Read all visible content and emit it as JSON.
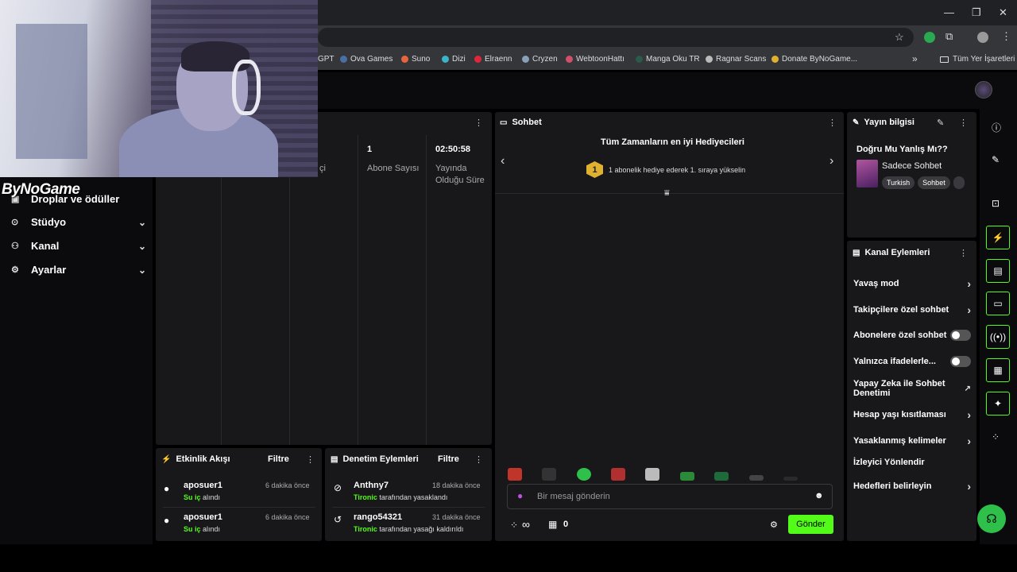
{
  "browser": {
    "bookmarks": [
      {
        "label": "GPT",
        "color": "#888"
      },
      {
        "label": "Ova Games",
        "color": "#4a6fa5"
      },
      {
        "label": "Suno",
        "color": "#e8643c"
      },
      {
        "label": "Dizi",
        "color": "#3cb4c8"
      },
      {
        "label": "Elraenn",
        "color": "#e0263b"
      },
      {
        "label": "Cryzen",
        "color": "#8aa0b8"
      },
      {
        "label": "WebtoonHattı",
        "color": "#d0506a"
      },
      {
        "label": "Manga Oku TR",
        "color": "#2a5a4a"
      },
      {
        "label": "Ragnar Scans",
        "color": "#bbbbbb"
      },
      {
        "label": "Donate ByNoGame...",
        "color": "#e0b030"
      }
    ],
    "more_bookmarks": "»",
    "all_bookmarks": "Tüm Yer İşaretleri"
  },
  "overlay": {
    "logo_text": "ByNoGame"
  },
  "sidebar": {
    "partial_item": "Droplar ve ödüller",
    "items": [
      {
        "label": "Stüdyo",
        "icon": "studio-icon"
      },
      {
        "label": "Kanal",
        "icon": "users-icon"
      },
      {
        "label": "Ayarlar",
        "icon": "gear-icon"
      }
    ]
  },
  "stats": {
    "partial_label": "çi",
    "subscribers": {
      "value": "1",
      "label": "Abone Sayısı"
    },
    "uptime": {
      "value": "02:50:58",
      "label": "Yayında Olduğu Süre"
    }
  },
  "activity": {
    "title": "Etkinlik Akışı",
    "filter": "Filtre",
    "items": [
      {
        "user": "aposuer1",
        "time": "6 dakika önce",
        "highlight": "Su iç",
        "rest": " alındı"
      },
      {
        "user": "aposuer1",
        "time": "6 dakika önce",
        "highlight": "Su iç",
        "rest": " alındı"
      }
    ]
  },
  "moderation": {
    "title": "Denetim Eylemleri",
    "filter": "Filtre",
    "items": [
      {
        "user": "Anthny7",
        "time": "18 dakika önce",
        "highlight": "Tironic",
        "rest": " tarafından yasaklandı"
      },
      {
        "user": "rango54321",
        "time": "31 dakika önce",
        "highlight": "Tironic",
        "rest": " tarafından yasağı kaldırıldı"
      }
    ]
  },
  "chat": {
    "title": "Sohbet",
    "gifters_title": "Tüm Zamanların en iyi Hediyecileri",
    "rank_badge": "1",
    "gifters_text": "1 abonelik hediye ederek 1. sıraya yükselin",
    "input_placeholder": "Bir mesaj gönderin",
    "viewers_symbol": "∞",
    "gift_count": "0",
    "send_label": "Gönder"
  },
  "stream_info": {
    "title": "Yayın bilgisi",
    "stream_title": "Doğru Mu Yanlış Mı??",
    "category": "Sadece Sohbet",
    "tags": [
      "Turkish",
      "Sohbet"
    ]
  },
  "channel_actions": {
    "title": "Kanal Eylemleri",
    "items": [
      {
        "label": "Yavaş mod",
        "control": "arrow"
      },
      {
        "label": "Takipçilere özel sohbet",
        "control": "arrow"
      },
      {
        "label": "Abonelere özel sohbet",
        "control": "toggle",
        "on": false
      },
      {
        "label": "Yalnızca ifadelerle...",
        "control": "toggle",
        "on": false
      },
      {
        "label": "Yapay Zeka ile Sohbet Denetimi",
        "control": "external"
      },
      {
        "label": "Hesap yaşı kısıtlaması",
        "control": "arrow"
      },
      {
        "label": "Yasaklanmış kelimeler",
        "control": "arrow"
      },
      {
        "label": "İzleyici Yönlendir",
        "control": "none"
      },
      {
        "label": "Hedefleri belirleyin",
        "control": "arrow"
      }
    ]
  },
  "colors": {
    "accent": "#53fc18",
    "panel": "#18181b",
    "background": "#0b0b0d"
  }
}
